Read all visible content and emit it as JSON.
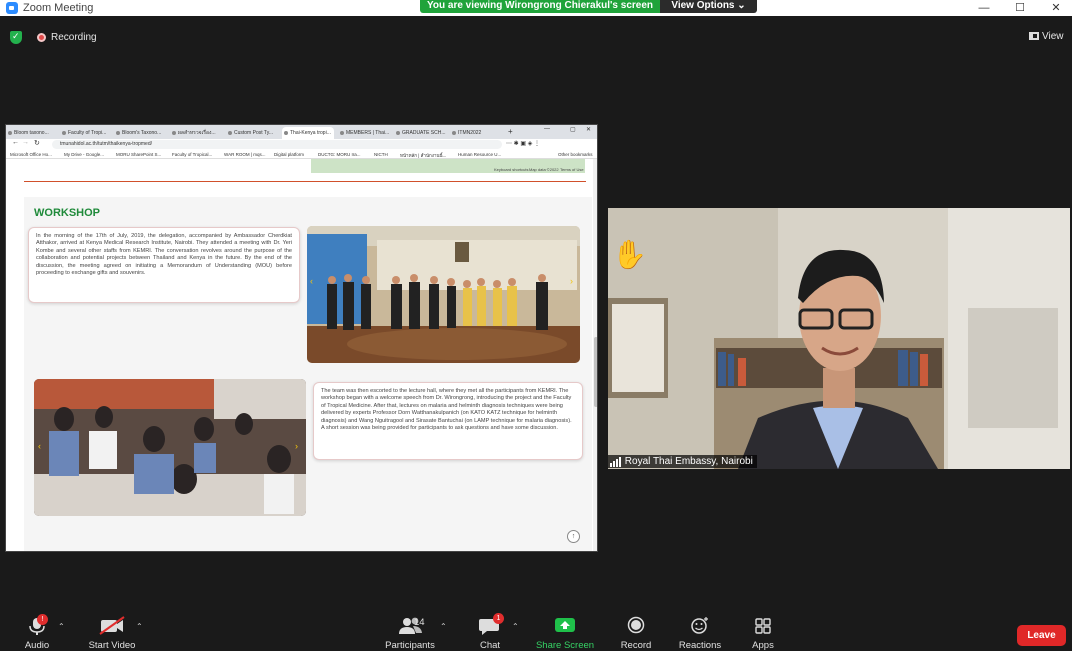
{
  "window": {
    "title": "Zoom Meeting",
    "share_banner": "You are viewing Wirongrong Chierakul's screen",
    "view_options": "View Options",
    "recording": "Recording",
    "view": "View"
  },
  "browser": {
    "tabs": [
      "Bloom taxono...",
      "Faculty of Tropi...",
      "Bloom's Taxono...",
      "ผลสำหรวจเรื่อง...",
      "Custom Post Ty...",
      "Thai-Kenya tropi...",
      "MEMBERS | Thai...",
      "GRADUATE SCH...",
      "ITMN2022"
    ],
    "active_tab_index": 5,
    "url": "tmunahidol.ac.th/tutm/thaikenya-tropmed/",
    "bookmarks": [
      "Microsoft Office Ho...",
      "My Drive - Google...",
      "MORU SharePoint S...",
      "Faculty of Tropical...",
      "WAR ROOM | mqs...",
      "Digital platform",
      "DUCTG: MORU Ira...",
      "NICTH",
      "หน้าหลัก | สำนักงานนี้...",
      "Human Resource U...",
      "Other bookmarks"
    ],
    "map_labels": [
      "Keyboard shortcuts",
      "Map data ©2022",
      "Terms of Use"
    ]
  },
  "page": {
    "section_title": "WORKSHOP",
    "paragraph1": "In the morning of the 17th of July, 2019, the delegation, accompanied by Ambassador Cherdkiat Atthakor, arrived at Kenya Medical Research Institute, Nairobi. They attended a meeting with Dr. Yeri Kombe and several other staffs from KEMRI. The conversation revolves around the purpose of the collaboration and potential projects between Thailand and Kenya in the future. By the end of the discussion, the meeting agreed on initiating a Memorandum of Understanding (MOU) before proceeding to exchange gifts and souvenirs.",
    "paragraph2": "The team was then escorted to the lecture hall, where they met all the participants from KEMRI. The workshop began with a welcome speech from Dr. Wirongrong, introducing the project and the Faculty of Tropical Medicine. After that, lectures on malaria and helminth diagnosis techniques were being delivered by experts Professor Dorn Watthanakulpanich (on KATO KATZ technique for helminth diagnosis) and Wang Nguitragool and Sirasate Bantuchai (on LAMP technique for malaria diagnosis). A short session was being provided for participants to ask questions and have some discussion."
  },
  "participant": {
    "name": "Royal Thai Embassy, Nairobi"
  },
  "toolbar": {
    "audio": "Audio",
    "start_video": "Start Video",
    "participants": "Participants",
    "participants_count": "14",
    "chat": "Chat",
    "chat_badge": "1",
    "audio_badge": "!",
    "share_screen": "Share Screen",
    "record": "Record",
    "reactions": "Reactions",
    "apps": "Apps",
    "leave": "Leave"
  },
  "colors": {
    "share_green": "#1fa33a",
    "workshop_green": "#1f8a3a",
    "accent_red": "#d1502b",
    "leave_red": "#e02828"
  }
}
